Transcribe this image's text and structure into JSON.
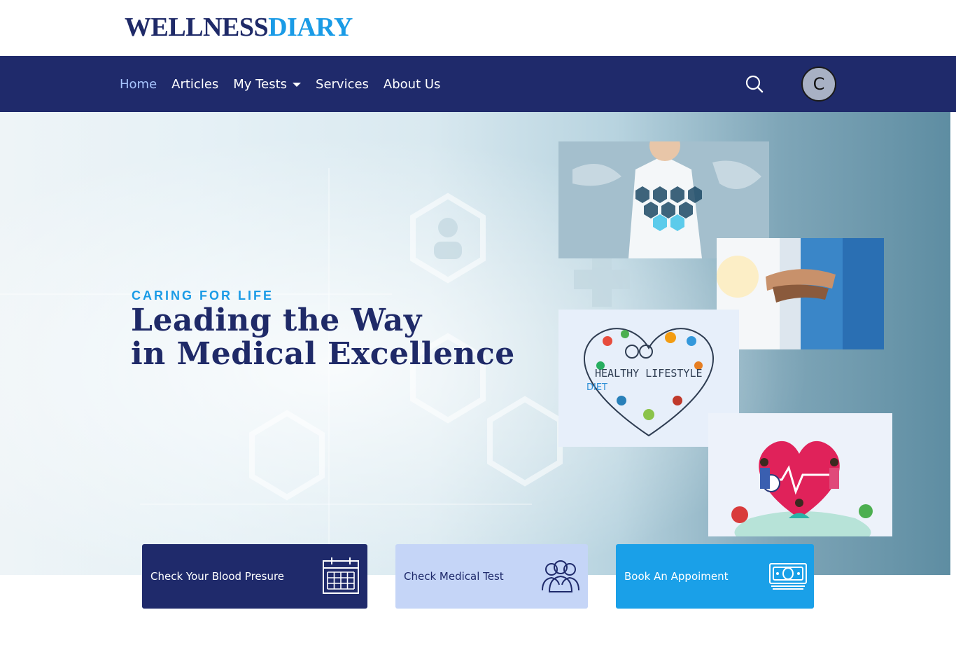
{
  "brand": {
    "name_part1": "WELLNESS",
    "name_part2": "DIARY"
  },
  "nav": {
    "items": [
      {
        "label": "Home",
        "active": true
      },
      {
        "label": "Articles"
      },
      {
        "label": "My Tests",
        "has_dropdown": true
      },
      {
        "label": "Services"
      },
      {
        "label": "About Us"
      }
    ],
    "search_icon": "search-icon",
    "avatar_initial": "C"
  },
  "hero": {
    "eyebrow": "CARING FOR LIFE",
    "title_line1": "Leading the Way",
    "title_line2": "in Medical Excellence",
    "images": [
      {
        "name": "doctor-digital-health-image",
        "caption": ""
      },
      {
        "name": "teamwork-hands-image",
        "caption": ""
      },
      {
        "name": "healthy-lifestyle-heart-image",
        "caption": "HEALTHY LIFESTYLE"
      },
      {
        "name": "heart-health-illustration-image",
        "caption": ""
      }
    ]
  },
  "cards": [
    {
      "label": "Check Your Blood Presure",
      "icon": "calendar-icon",
      "color": "#1f2a6b"
    },
    {
      "label": "Check Medical Test",
      "icon": "users-icon",
      "color": "#c5d5f7"
    },
    {
      "label": "Book An Appoiment",
      "icon": "money-icon",
      "color": "#1aa0e8"
    }
  ],
  "colors": {
    "navy": "#1f2a6b",
    "accent": "#1a9be6",
    "light_blue": "#c5d5f7"
  }
}
